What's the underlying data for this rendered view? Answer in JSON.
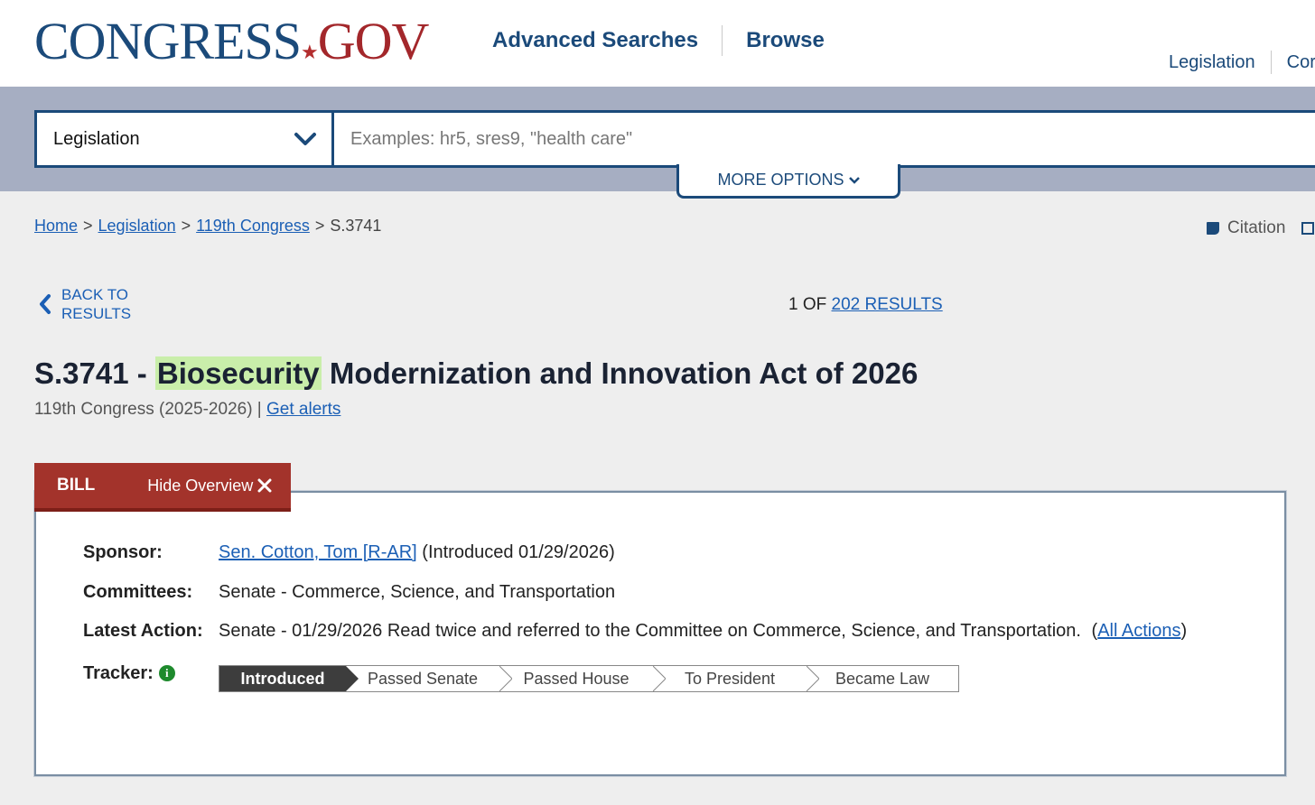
{
  "header": {
    "logo_left": "CONGRESS",
    "logo_star": "★",
    "logo_right": "GOV",
    "nav": [
      "Advanced Searches",
      "Browse"
    ],
    "right_nav": [
      "Legislation",
      "Cor"
    ]
  },
  "search": {
    "scope": "Legislation",
    "placeholder": "Examples: hr5, sres9, \"health care\"",
    "more_options": "MORE OPTIONS"
  },
  "breadcrumb": {
    "home": "Home",
    "legislation": "Legislation",
    "congress": "119th Congress",
    "current": "S.3741",
    "sep": ">"
  },
  "tools": {
    "citation": "Citation"
  },
  "back": {
    "line1": "BACK TO",
    "line2": "RESULTS"
  },
  "results": {
    "prefix": "1 OF",
    "link": "202 RESULTS"
  },
  "bill": {
    "number": "S.3741 -",
    "highlight": "Biosecurity",
    "title_rest": "Modernization and Innovation Act of 2026",
    "congress": "119th Congress (2025-2026) |",
    "alerts": "Get alerts"
  },
  "overview": {
    "tab": "BILL",
    "hide": "Hide Overview",
    "sponsor_label": "Sponsor:",
    "sponsor_name": "Sen. Cotton, Tom [R-AR]",
    "sponsor_intro": "(Introduced 01/29/2026)",
    "committees_label": "Committees:",
    "committees": "Senate - Commerce, Science, and Transportation",
    "latest_label": "Latest Action:",
    "latest": "Senate - 01/29/2026 Read twice and referred to the Committee on Commerce, Science, and Transportation.",
    "all_actions_open": "(",
    "all_actions": "All Actions",
    "all_actions_close": ")",
    "tracker_label": "Tracker:",
    "tracker_steps": [
      "Introduced",
      "Passed Senate",
      "Passed House",
      "To President",
      "Became Law"
    ],
    "tracker_active": 0
  },
  "colors": {
    "brand_blue": "#1b4a7a",
    "brand_red": "#a3272b",
    "link": "#1b5fb5",
    "highlight": "#c9eeaa"
  }
}
